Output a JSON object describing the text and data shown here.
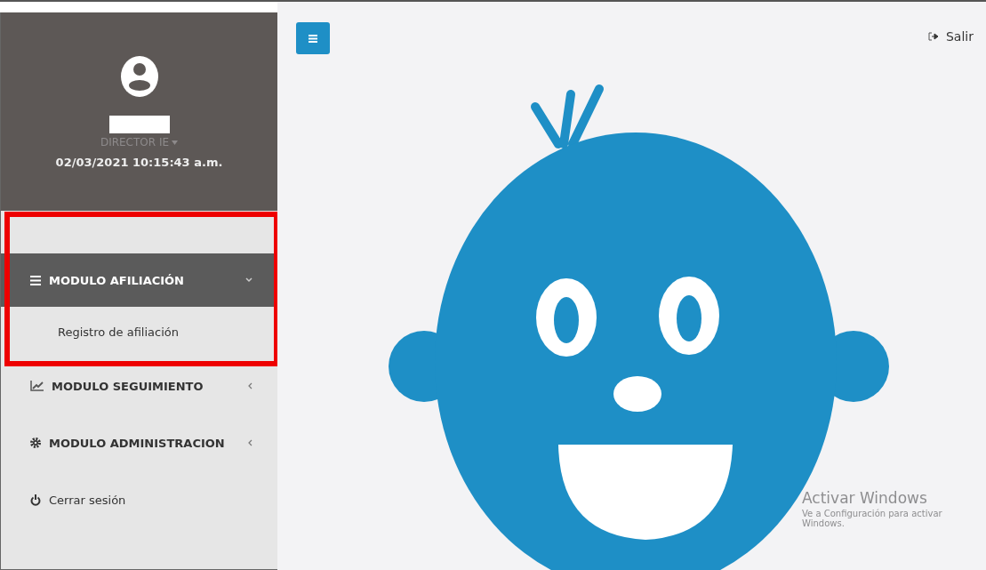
{
  "user": {
    "role": "DIRECTOR IE",
    "datetime": "02/03/2021 10:15:43 a.m."
  },
  "menu": [
    {
      "label": "MODULO AFILIACIÓN",
      "kind": "module",
      "selected": true,
      "expanded": true,
      "children": [
        {
          "label": "Registro de afiliación"
        }
      ]
    },
    {
      "label": "MODULO SEGUIMIENTO",
      "kind": "module",
      "selected": false,
      "expanded": false
    },
    {
      "label": "MODULO ADMINISTRACION",
      "kind": "module",
      "selected": false,
      "expanded": false
    },
    {
      "label": "Cerrar sesión",
      "kind": "action",
      "selected": false
    }
  ],
  "header": {
    "logout": "Salir"
  },
  "windows_notice": {
    "title": "Activar Windows",
    "text": "Ve a Configuración para activar Windows."
  }
}
